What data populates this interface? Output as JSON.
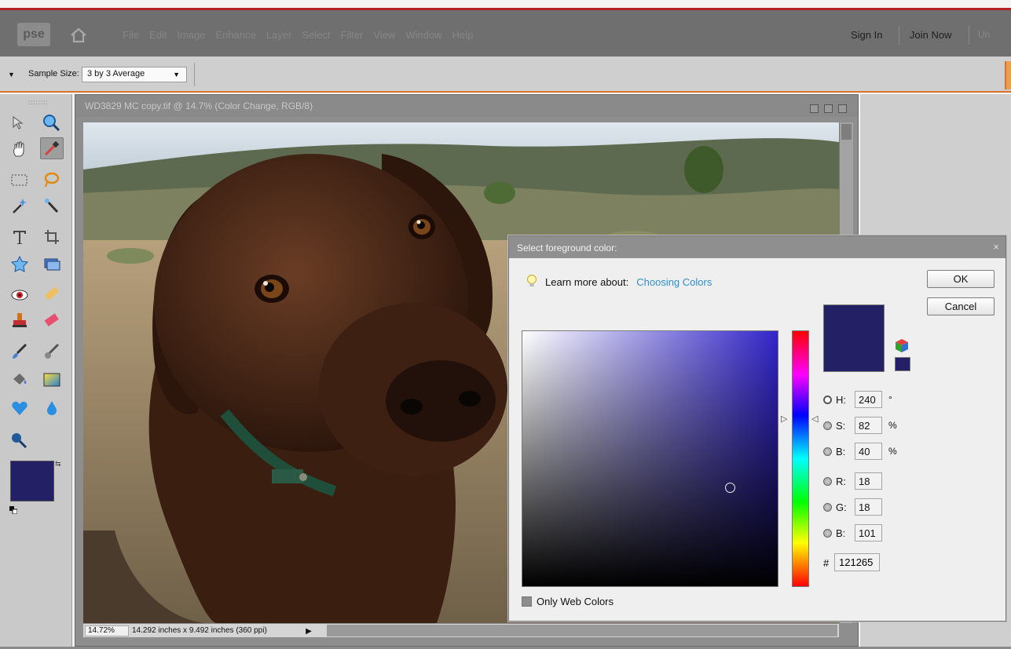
{
  "app": {
    "logo": "pse",
    "menus": [
      "File",
      "Edit",
      "Image",
      "Enhance",
      "Layer",
      "Select",
      "Filter",
      "View",
      "Window",
      "Help"
    ],
    "sign_in": "Sign In",
    "join_now": "Join Now",
    "undo_stub": "Un"
  },
  "options_bar": {
    "sample_size_label": "Sample Size:",
    "sample_size_value": "3 by 3 Average"
  },
  "document": {
    "title": "WD3829 MC copy.tif @ 14.7% (Color Change, RGB/8)",
    "zoom": "14.72%",
    "info": "14.292 inches x 9.492 inches (360 ppi)"
  },
  "toolbox": {
    "foreground_color": "#232066",
    "background_color": "#ffffff"
  },
  "dialog": {
    "title": "Select foreground color:",
    "learn_more_label": "Learn more about:",
    "learn_more_link": "Choosing Colors",
    "ok_label": "OK",
    "cancel_label": "Cancel",
    "hue_base_color": "#3225c9",
    "new_color": "#232066",
    "fields": {
      "H": {
        "label": "H:",
        "value": "240",
        "unit": "°"
      },
      "S": {
        "label": "S:",
        "value": "82",
        "unit": "%"
      },
      "Bri": {
        "label": "B:",
        "value": "40",
        "unit": "%"
      },
      "R": {
        "label": "R:",
        "value": "18"
      },
      "G": {
        "label": "G:",
        "value": "18"
      },
      "Blue": {
        "label": "B:",
        "value": "101"
      }
    },
    "hex_label": "#",
    "hex_value": "121265",
    "only_web_colors_label": "Only Web Colors"
  },
  "colors": {
    "menubar_accent": "#b32424",
    "optionsbar_accent": "#d9702c",
    "link": "#2f8fd0"
  }
}
